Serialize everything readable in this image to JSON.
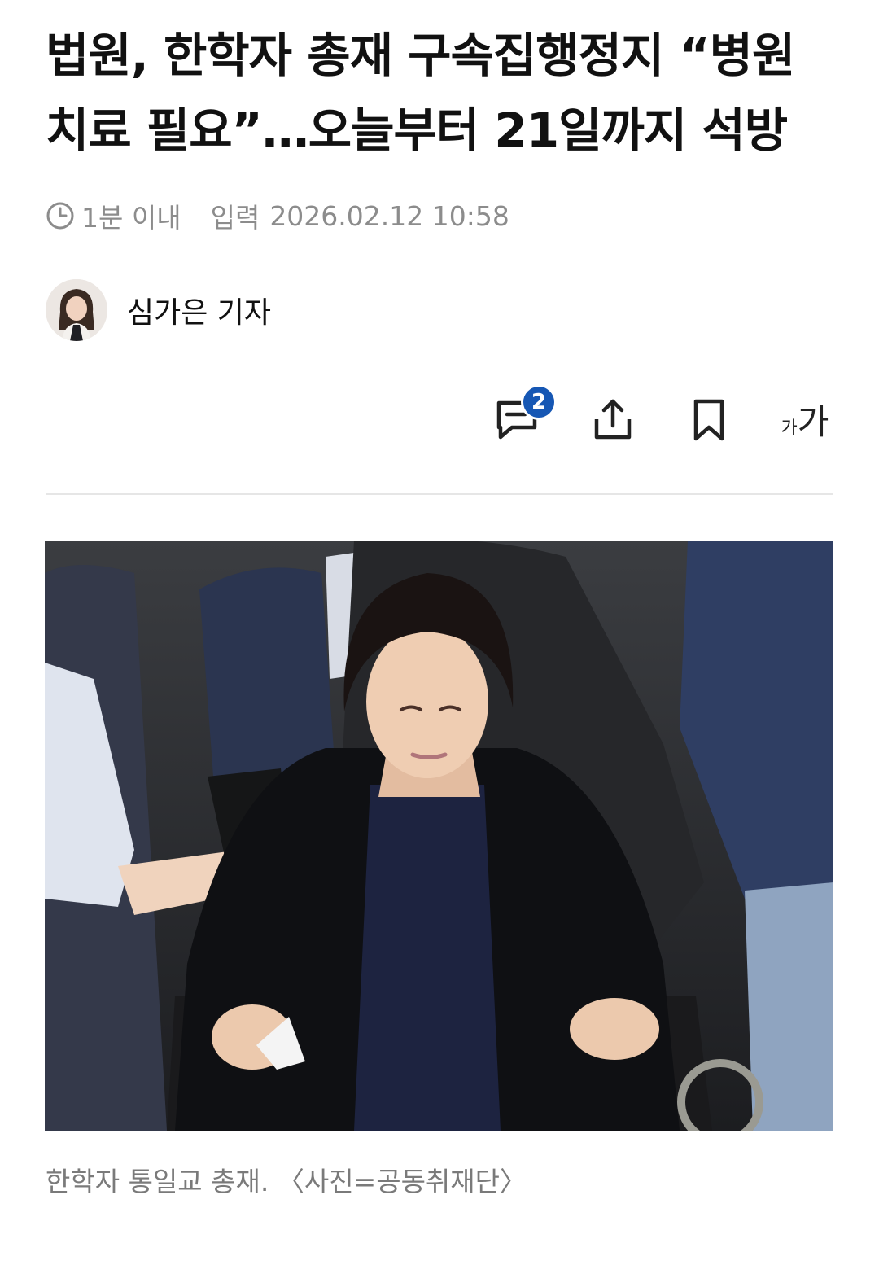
{
  "article": {
    "headline": "법원, 한학자 총재 구속집행정지 “병원 치료 필요”…오늘부터 21일까지 석방",
    "read_time": "1분 이내",
    "published_label": "입력",
    "published_at": "2026.02.12 10:58"
  },
  "reporter": {
    "name": "심가은 기자"
  },
  "toolbar": {
    "comment_count": "2",
    "font_small": "가",
    "font_big": "가"
  },
  "photo": {
    "caption": "한학자 통일교 총재. 〈사진=공동취재단〉"
  },
  "colors": {
    "badge": "#1657b4",
    "meta_text": "#8c8c8c",
    "caption_text": "#7a7a7a",
    "divider": "#e6e6e6"
  },
  "icons": [
    "clock-icon",
    "comment-icon",
    "share-icon",
    "bookmark-icon",
    "font-size-icon"
  ]
}
